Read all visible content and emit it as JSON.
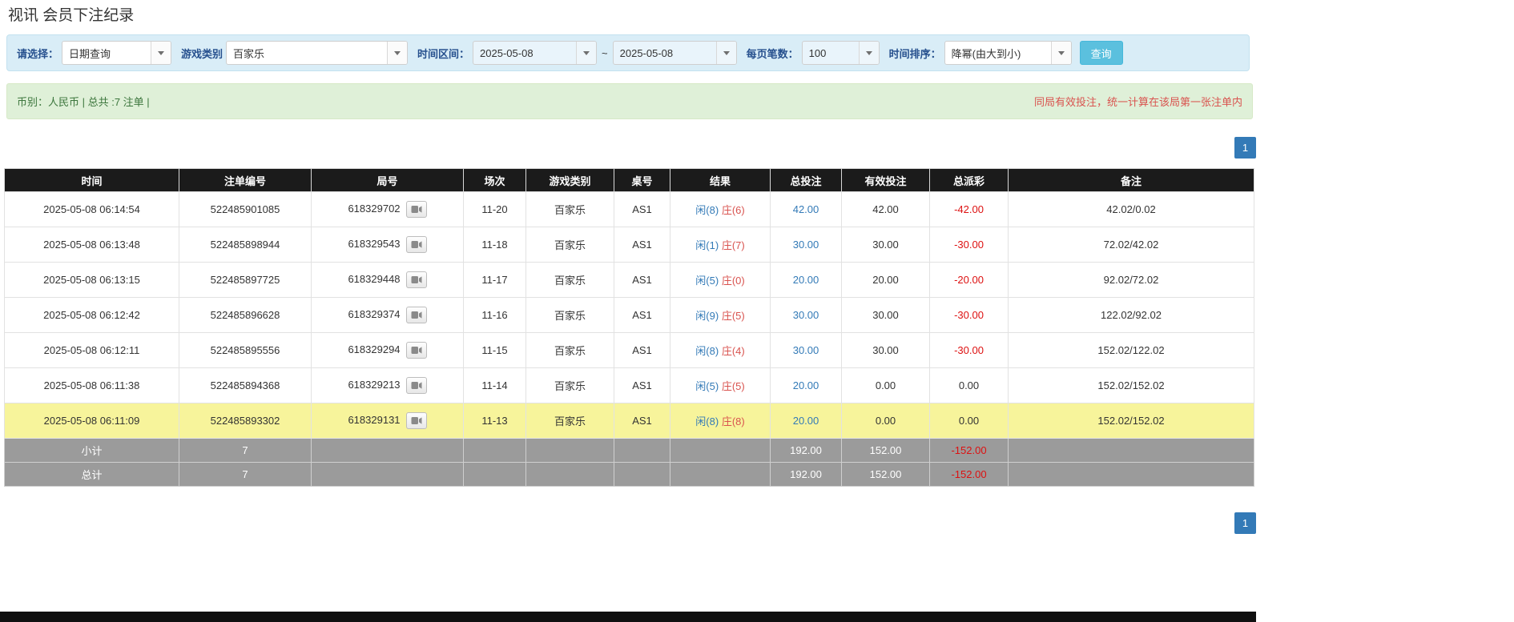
{
  "page": {
    "title": "视讯 会员下注纪录"
  },
  "filters": {
    "select_label": "请选择：",
    "select_value": "日期查询",
    "game_label": "游戏类别",
    "game_value": "百家乐",
    "range_label": "时间区间：",
    "date_from": "2025-05-08",
    "tilde": "~",
    "date_to": "2025-05-08",
    "page_size_label": "每页笔数：",
    "page_size_value": "100",
    "sort_label": "时间排序：",
    "sort_value": "降幂(由大到小)",
    "search_label": "查询"
  },
  "notice": {
    "left": "币别：人民币 | 总共 :7 注单 |",
    "right": "同局有效投注，统一计算在该局第一张注单内"
  },
  "pagination": {
    "current": "1"
  },
  "colors": {
    "accent_blue": "#337ab7",
    "info_button_blue": "#5bc0de",
    "player_blue": "#337ab7",
    "banker_red": "#d9534f",
    "negative_red": "#dd1111",
    "highlight_yellow": "#f7f49b",
    "header_black": "#1b1b1b",
    "summary_gray": "#9b9b9b"
  },
  "table": {
    "headers": [
      "时间",
      "注单编号",
      "局号",
      "场次",
      "游戏类别",
      "桌号",
      "结果",
      "总投注",
      "有效投注",
      "总派彩",
      "备注"
    ],
    "rows": [
      {
        "time": "2025-05-08 06:14:54",
        "bet_id": "522485901085",
        "round_id": "618329702",
        "session": "11-20",
        "game": "百家乐",
        "table_no": "AS1",
        "result_player": "闲(8)",
        "result_banker": "庄(6)",
        "total_bet": "42.00",
        "valid_bet": "42.00",
        "payout": "-42.00",
        "remark": "42.02/0.02"
      },
      {
        "time": "2025-05-08 06:13:48",
        "bet_id": "522485898944",
        "round_id": "618329543",
        "session": "11-18",
        "game": "百家乐",
        "table_no": "AS1",
        "result_player": "闲(1)",
        "result_banker": "庄(7)",
        "total_bet": "30.00",
        "valid_bet": "30.00",
        "payout": "-30.00",
        "remark": "72.02/42.02"
      },
      {
        "time": "2025-05-08 06:13:15",
        "bet_id": "522485897725",
        "round_id": "618329448",
        "session": "11-17",
        "game": "百家乐",
        "table_no": "AS1",
        "result_player": "闲(5)",
        "result_banker": "庄(0)",
        "total_bet": "20.00",
        "valid_bet": "20.00",
        "payout": "-20.00",
        "remark": "92.02/72.02"
      },
      {
        "time": "2025-05-08 06:12:42",
        "bet_id": "522485896628",
        "round_id": "618329374",
        "session": "11-16",
        "game": "百家乐",
        "table_no": "AS1",
        "result_player": "闲(9)",
        "result_banker": "庄(5)",
        "total_bet": "30.00",
        "valid_bet": "30.00",
        "payout": "-30.00",
        "remark": "122.02/92.02"
      },
      {
        "time": "2025-05-08 06:12:11",
        "bet_id": "522485895556",
        "round_id": "618329294",
        "session": "11-15",
        "game": "百家乐",
        "table_no": "AS1",
        "result_player": "闲(8)",
        "result_banker": "庄(4)",
        "total_bet": "30.00",
        "valid_bet": "30.00",
        "payout": "-30.00",
        "remark": "152.02/122.02"
      },
      {
        "time": "2025-05-08 06:11:38",
        "bet_id": "522485894368",
        "round_id": "618329213",
        "session": "11-14",
        "game": "百家乐",
        "table_no": "AS1",
        "result_player": "闲(5)",
        "result_banker": "庄(5)",
        "total_bet": "20.00",
        "valid_bet": "0.00",
        "payout": "0.00",
        "remark": "152.02/152.02"
      },
      {
        "time": "2025-05-08 06:11:09",
        "bet_id": "522485893302",
        "round_id": "618329131",
        "session": "11-13",
        "game": "百家乐",
        "table_no": "AS1",
        "result_player": "闲(8)",
        "result_banker": "庄(8)",
        "total_bet": "20.00",
        "valid_bet": "0.00",
        "payout": "0.00",
        "remark": "152.02/152.02"
      }
    ],
    "subtotal": {
      "label": "小计",
      "count": "7",
      "total_bet": "192.00",
      "valid_bet": "152.00",
      "payout": "-152.00"
    },
    "grand_total": {
      "label": "总计",
      "count": "7",
      "total_bet": "192.00",
      "valid_bet": "152.00",
      "payout": "-152.00"
    }
  }
}
